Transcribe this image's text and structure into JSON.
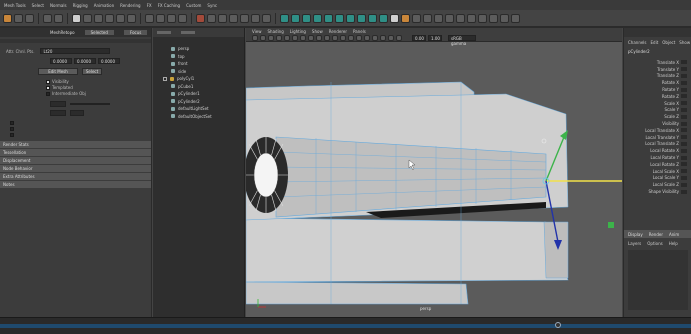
{
  "menu": [
    {
      "label": "Mesh Tools"
    },
    {
      "label": "Select"
    },
    {
      "label": "Normals"
    },
    {
      "label": "Rigging"
    },
    {
      "label": "Animation"
    },
    {
      "label": "Rendering"
    },
    {
      "label": "FX"
    },
    {
      "label": "FX Caching"
    },
    {
      "label": "Custom"
    },
    {
      "label": "Sync"
    }
  ],
  "attribute_editor": {
    "tabs": [
      "MeshRetopo",
      "Selected",
      "Focus"
    ],
    "node_label": "Attr. Chnl. Pts.",
    "node_value": "Lt20",
    "transform_fields": [
      "0.0000",
      "0.0000",
      "0.0000"
    ],
    "buttons": [
      "Edit Mesh",
      "Select"
    ],
    "options": [
      "Visibility",
      "Templated",
      "Intermediate Obj"
    ],
    "sections": [
      "Render Stats",
      "Tessellation",
      "Displacement",
      "Node Behavior",
      "Extra Attributes",
      "Notes"
    ]
  },
  "outliner": {
    "items": [
      "persp",
      "top",
      "front",
      "side",
      "polyCyl1",
      "pCube1",
      "pCylinder1",
      "pCylinder2",
      "defaultLightSet",
      "defaultObjectSet"
    ]
  },
  "viewport": {
    "menus": [
      "View",
      "Shading",
      "Lighting",
      "Show",
      "Renderer",
      "Panels"
    ],
    "camera_label": "persp",
    "field_value": "0.00",
    "field_value_2": "1.00",
    "color_space": "sRGB gamma"
  },
  "channel_box": {
    "tabs": [
      "Channels",
      "Edit",
      "Object",
      "Show"
    ],
    "object_name": "pCylinder2",
    "attributes": [
      "Translate X",
      "Translate Y",
      "Translate Z",
      "Rotate X",
      "Rotate Y",
      "Rotate Z",
      "Scale X",
      "Scale Y",
      "Scale Z",
      "Visibility",
      "Local Translate X",
      "Local Translate Y",
      "Local Translate Z",
      "Local Rotate X",
      "Local Rotate Y",
      "Local Rotate Z",
      "Local Scale X",
      "Local Scale Y",
      "Local Scale Z",
      "Shape Visibility"
    ],
    "layer_tabs": [
      "Display",
      "Render",
      "Anim"
    ],
    "layer_menu": [
      "Layers",
      "Options",
      "Help"
    ]
  },
  "colors": {
    "axis_x": "#f2e14a",
    "axis_y": "#3cb34a",
    "axis_z": "#2233aa",
    "wire": "#66ccee",
    "timeline_fill": "#1f4a6e"
  }
}
